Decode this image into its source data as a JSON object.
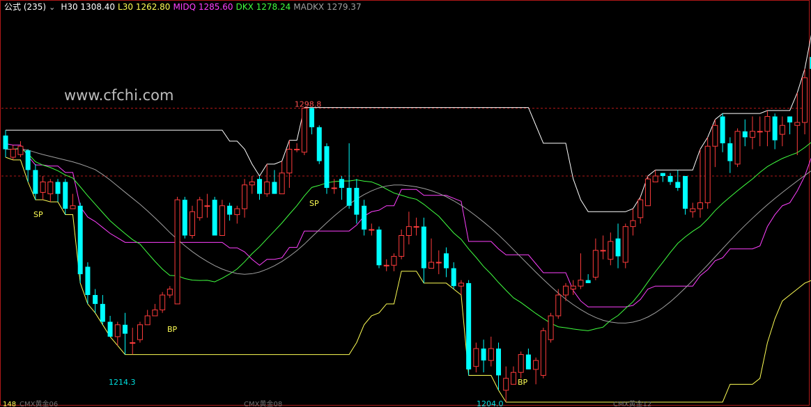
{
  "legend": {
    "formula": "公式 (235)",
    "chevron": "⌄",
    "items": [
      {
        "key": "H30",
        "text": "H30 1308.40",
        "color": "#ffffff"
      },
      {
        "key": "L30",
        "text": "L30 1262.80",
        "color": "#ffff55"
      },
      {
        "key": "MIDQ",
        "text": "MIDQ 1285.60",
        "color": "#ff40ff"
      },
      {
        "key": "DKX",
        "text": "DKX 1278.24",
        "color": "#40ff40"
      },
      {
        "key": "MADKX",
        "text": "MADKX 1279.37",
        "color": "#a0a0a0"
      }
    ]
  },
  "watermark": "www.cfchi.com",
  "colors": {
    "up": "#ff3c3c",
    "down": "#00ffff",
    "H30": "#ffffff",
    "L30": "#ffff55",
    "MIDQ": "#ff40ff",
    "DKX": "#40ff40",
    "MADKX": "#a0a0a0",
    "signal": "#ffff55",
    "grid": "#b01818"
  },
  "annotations": {
    "high_price": "1298.8",
    "low_price_1": "1214.3",
    "low_price_2": "1204.0"
  },
  "signals": [
    "SP",
    "SP",
    "BP",
    "BP"
  ],
  "bottom_labels": [
    "148",
    "CMX黄金06",
    "CMX黄金08",
    "CMX黄金12"
  ],
  "chart_data": {
    "type": "candlestick",
    "y_axis": {
      "min": 1200,
      "max": 1330
    },
    "reference_levels": [
      1298.8,
      1276.0
    ],
    "candles": [
      [
        1289.6,
        1285,
        1291.4,
        1282.3
      ],
      [
        1282.3,
        1285,
        1286.4,
        1281.4
      ],
      [
        1283.2,
        1286,
        1287.7,
        1282.3
      ],
      [
        1284.6,
        1278,
        1285,
        1274
      ],
      [
        1278,
        1270,
        1280,
        1268
      ],
      [
        1270.5,
        1274,
        1276,
        1268
      ],
      [
        1270,
        1274,
        1275,
        1267.3
      ],
      [
        1274,
        1270,
        1275,
        1267.3
      ],
      [
        1274,
        1265,
        1275,
        1263
      ],
      [
        1265,
        1266,
        1270,
        1265
      ],
      [
        1266,
        1243,
        1267,
        1240
      ],
      [
        1245.5,
        1236,
        1247,
        1233
      ],
      [
        1236,
        1233,
        1238,
        1230
      ],
      [
        1233,
        1227,
        1236,
        1226
      ],
      [
        1227,
        1222,
        1229,
        1222
      ],
      [
        1222,
        1226,
        1227,
        1219
      ],
      [
        1226,
        1223,
        1230,
        1216
      ],
      [
        1220,
        1220,
        1225,
        1216
      ],
      [
        1221,
        1226,
        1227,
        1220
      ],
      [
        1226,
        1229,
        1231,
        1226
      ],
      [
        1229,
        1231,
        1233,
        1229
      ],
      [
        1231,
        1236,
        1237,
        1230
      ],
      [
        1236,
        1238,
        1239,
        1235
      ],
      [
        1233,
        1268,
        1269,
        1233
      ],
      [
        1268,
        1256,
        1269,
        1255
      ],
      [
        1256,
        1264,
        1266,
        1255
      ],
      [
        1262,
        1268,
        1269,
        1261
      ],
      [
        1266,
        1266,
        1270,
        1262
      ],
      [
        1268,
        1256,
        1269,
        1256
      ],
      [
        1256,
        1266,
        1268,
        1256
      ],
      [
        1266,
        1263,
        1267,
        1261
      ],
      [
        1263,
        1265,
        1266,
        1260
      ],
      [
        1265,
        1273,
        1275,
        1262
      ],
      [
        1273,
        1274,
        1276,
        1270
      ],
      [
        1275,
        1270,
        1276,
        1268
      ],
      [
        1270,
        1274,
        1280,
        1269
      ],
      [
        1274,
        1270,
        1278,
        1270
      ],
      [
        1270,
        1277,
        1281,
        1270
      ],
      [
        1277,
        1285,
        1288,
        1272
      ],
      [
        1285,
        1285,
        1287,
        1284
      ],
      [
        1284,
        1298.8,
        1299,
        1283
      ],
      [
        1298.8,
        1292.4,
        1299,
        1290
      ],
      [
        1292.4,
        1281,
        1293,
        1280
      ],
      [
        1286,
        1272,
        1287,
        1270
      ],
      [
        1272,
        1272,
        1275,
        1270
      ],
      [
        1275,
        1272,
        1276,
        1268
      ],
      [
        1272,
        1266,
        1287,
        1265
      ],
      [
        1272,
        1263,
        1275,
        1260
      ],
      [
        1266,
        1258,
        1268,
        1256
      ],
      [
        1258,
        1258,
        1260,
        1256
      ],
      [
        1258,
        1246,
        1259,
        1245
      ],
      [
        1246,
        1246,
        1248,
        1244
      ],
      [
        1246,
        1249,
        1250,
        1244
      ],
      [
        1249,
        1256,
        1258,
        1248
      ],
      [
        1256,
        1259,
        1264,
        1253
      ],
      [
        1259,
        1259,
        1262,
        1256
      ],
      [
        1259,
        1245,
        1262,
        1240
      ],
      [
        1245,
        1247,
        1255,
        1245
      ],
      [
        1247,
        1247,
        1251,
        1243
      ],
      [
        1250,
        1245,
        1252,
        1242
      ],
      [
        1245,
        1239,
        1247,
        1238
      ],
      [
        1239,
        1240,
        1241,
        1236
      ],
      [
        1240,
        1211,
        1241,
        1209
      ],
      [
        1212,
        1218,
        1220,
        1210
      ],
      [
        1218,
        1214,
        1221,
        1210
      ],
      [
        1214,
        1218,
        1222,
        1212
      ],
      [
        1218,
        1209,
        1220,
        1204
      ],
      [
        1204,
        1208,
        1212,
        1200
      ],
      [
        1206,
        1210,
        1212,
        1206
      ],
      [
        1210,
        1216,
        1217,
        1208
      ],
      [
        1216,
        1211,
        1218,
        1211
      ],
      [
        1211,
        1214,
        1215,
        1206
      ],
      [
        1209,
        1224,
        1225,
        1208
      ],
      [
        1221,
        1229,
        1230,
        1220
      ],
      [
        1229,
        1236,
        1238,
        1228
      ],
      [
        1236,
        1239,
        1240,
        1234
      ],
      [
        1238,
        1239,
        1241,
        1236
      ],
      [
        1239,
        1241,
        1250,
        1238
      ],
      [
        1241,
        1240,
        1243,
        1240
      ],
      [
        1242,
        1251,
        1255,
        1241
      ],
      [
        1251,
        1251,
        1256,
        1248
      ],
      [
        1248,
        1254,
        1257,
        1246
      ],
      [
        1255,
        1249,
        1260,
        1245
      ],
      [
        1247,
        1259,
        1260,
        1245
      ],
      [
        1259,
        1261,
        1265,
        1256
      ],
      [
        1262,
        1268,
        1269,
        1260
      ],
      [
        1266,
        1275,
        1276,
        1266
      ],
      [
        1274,
        1276,
        1278,
        1274
      ],
      [
        1277,
        1276,
        1277,
        1274
      ],
      [
        1276,
        1274,
        1277,
        1273
      ],
      [
        1274,
        1272,
        1278,
        1271
      ],
      [
        1276,
        1265,
        1276,
        1263
      ],
      [
        1264,
        1265,
        1267,
        1262
      ],
      [
        1265,
        1267,
        1285,
        1262
      ],
      [
        1267,
        1286,
        1289,
        1265
      ],
      [
        1286,
        1293,
        1295,
        1279
      ],
      [
        1296,
        1287,
        1297,
        1284
      ],
      [
        1287,
        1281,
        1289,
        1277
      ],
      [
        1280,
        1291,
        1292,
        1279
      ],
      [
        1291,
        1289,
        1295,
        1286
      ],
      [
        1289,
        1291,
        1296,
        1285
      ],
      [
        1291,
        1291,
        1296,
        1286
      ],
      [
        1291,
        1296,
        1298,
        1286
      ],
      [
        1296,
        1288,
        1297,
        1285
      ],
      [
        1290,
        1293,
        1296,
        1286
      ],
      [
        1296,
        1294,
        1296,
        1290
      ],
      [
        1293,
        1294,
        1304,
        1283
      ],
      [
        1294,
        1309,
        1312,
        1290
      ],
      [
        1316,
        1312,
        1325,
        1308
      ],
      [
        1312,
        1308,
        1320,
        1308
      ],
      [
        1300,
        1320,
        1321,
        1295
      ]
    ],
    "series": [
      {
        "name": "H30",
        "values": [
          1298.8,
          1298.8,
          1298.8,
          1298.8,
          1298.8,
          1298.8,
          1298.8,
          1298.8,
          1298.8,
          1298.8,
          1298.8,
          1298.8,
          1298.8,
          1298.8,
          1298.8,
          1298.8,
          1298.8,
          1298.8,
          1298.8,
          1298.8,
          1298.8,
          1298.8,
          1298.8,
          1298.8,
          1298.8,
          1298.8,
          1298.8,
          1298.8,
          1298.8,
          1298.8,
          1298.8,
          1298.8,
          1298.8,
          1298.8,
          1298.8,
          1298.8,
          1298.8,
          1298.8,
          1298.8,
          1298.8,
          1298.8,
          1298.8,
          1298.8,
          1298.8,
          1298.8,
          1298.8,
          1298.8,
          1298.8,
          1298.8,
          1298.8,
          1298.8,
          1298.8,
          1298.8,
          1298.8,
          1298.8,
          1298.8,
          1298.8,
          1298.8,
          1298.8,
          1298.8,
          1298.8,
          1298.8,
          1298.8,
          1298.8,
          1298.8,
          1298.8,
          1298.8,
          1298.8,
          1298.8,
          1298.8,
          1298.8,
          1298.8,
          1298.8,
          1298.8,
          1298.8,
          1298.8,
          1298.8,
          1298.8,
          1298.8,
          1298.8,
          1298.8,
          1298.8,
          1298.8,
          1298.8,
          1298.8,
          1298.8,
          1298.8,
          1298.8,
          1298.8,
          1298.8,
          1298.8,
          1298.8,
          1298.8,
          1298.8,
          1298.8,
          1298.8,
          1298.8,
          1298.8,
          1298.8,
          1298.8,
          1298.8,
          1298.8,
          1298.8,
          1298.8,
          1298.8,
          1298.8,
          1298.8,
          1298.8,
          1308.4,
          1308.4
        ]
      },
      {
        "name": "L30",
        "values": [
          1214.3,
          1214.3,
          1214.3,
          1214.3,
          1214.3,
          1214.3,
          1214.3,
          1214.3,
          1214.3,
          1214.3,
          1214.3,
          1214.3,
          1214.3,
          1214.3,
          1214.3,
          1214.3,
          1214.3,
          1214.3,
          1214.3,
          1214.3,
          1214.3,
          1214.3,
          1214.3,
          1214.3,
          1214.3,
          1214.3,
          1214.3,
          1214.3,
          1214.3,
          1214.3,
          1214.3,
          1214.3,
          1214.3,
          1214.3,
          1214.3,
          1214.3,
          1214.3,
          1214.3,
          1214.3,
          1214.3,
          1214.3,
          1214.3,
          1214.3,
          1214.3,
          1214.3,
          1214.3,
          1214.3,
          1214.3,
          1214.3,
          1214.3,
          1214.3,
          1214.3,
          1214.3,
          1214.3,
          1214.3,
          1214.3,
          1214.3,
          1214.3,
          1214.3,
          1214.3,
          1214.3,
          1214.3,
          1214.3,
          1214.3,
          1214.3,
          1214.3,
          1204.0,
          1204.0,
          1204.0,
          1204.0,
          1204.0,
          1204.0,
          1204.0,
          1204.0,
          1204.0,
          1204.0,
          1204.0,
          1204.0,
          1204.0,
          1204.0,
          1204.0,
          1204.0,
          1204.0,
          1204.0,
          1204.0,
          1204.0,
          1204.0,
          1204.0,
          1204.0,
          1204.0,
          1204.0,
          1204.0,
          1204.0,
          1204.0,
          1204.0,
          1204.0,
          1204.0,
          1204.0,
          1204.0,
          1204.0,
          1204.0,
          1204.0,
          1204.0,
          1204.0,
          1204.0,
          1204.0,
          1204.0,
          1204.0,
          1262.8,
          1262.8
        ]
      },
      {
        "name": "MIDQ",
        "values": [
          1285.6,
          1285.6,
          1285.6,
          1285.6,
          1285.6,
          1285.6,
          1285.6,
          1285.6,
          1285.6,
          1285.6,
          1285.6,
          1285.6,
          1285.6,
          1285.6,
          1285.6,
          1285.6,
          1285.6,
          1285.6,
          1285.6,
          1285.6,
          1285.6,
          1285.6,
          1285.6,
          1285.6,
          1285.6,
          1285.6,
          1285.6,
          1285.6,
          1285.6,
          1285.6,
          1285.6,
          1285.6,
          1285.6,
          1285.6,
          1285.6,
          1285.6,
          1285.6,
          1285.6,
          1285.6,
          1285.6,
          1285.6,
          1285.6,
          1285.6,
          1285.6,
          1285.6,
          1285.6,
          1285.6,
          1285.6,
          1285.6,
          1285.6,
          1285.6,
          1285.6,
          1285.6,
          1285.6,
          1285.6,
          1285.6,
          1285.6,
          1285.6,
          1285.6,
          1285.6,
          1285.6,
          1285.6,
          1285.6,
          1285.6,
          1285.6,
          1285.6,
          1285.6,
          1285.6,
          1285.6,
          1285.6,
          1285.6,
          1285.6,
          1285.6,
          1285.6,
          1285.6,
          1285.6,
          1285.6,
          1285.6,
          1285.6,
          1285.6,
          1285.6,
          1285.6,
          1285.6,
          1285.6,
          1285.6,
          1285.6,
          1285.6,
          1285.6,
          1285.6,
          1285.6,
          1285.6,
          1285.6,
          1285.6,
          1285.6,
          1285.6,
          1285.6,
          1285.6,
          1285.6,
          1285.6,
          1285.6,
          1285.6,
          1285.6,
          1285.6,
          1285.6,
          1285.6,
          1285.6,
          1285.6,
          1285.6,
          1285.6,
          1285.6
        ]
      },
      {
        "name": "DKX",
        "values": [
          1278.24,
          1278.24,
          1278.24,
          1278.24,
          1278.24,
          1278.24,
          1278.24,
          1278.24,
          1278.24,
          1278.24,
          1278.24,
          1278.24,
          1278.24,
          1278.24,
          1278.24,
          1278.24,
          1278.24,
          1278.24,
          1278.24,
          1278.24,
          1278.24,
          1278.24,
          1278.24,
          1278.24,
          1278.24,
          1278.24,
          1278.24,
          1278.24,
          1278.24,
          1278.24,
          1278.24,
          1278.24,
          1278.24,
          1278.24,
          1278.24,
          1278.24,
          1278.24,
          1278.24,
          1278.24,
          1278.24,
          1278.24,
          1278.24,
          1278.24,
          1278.24,
          1278.24,
          1278.24,
          1278.24,
          1278.24,
          1278.24,
          1278.24,
          1278.24,
          1278.24,
          1278.24,
          1278.24,
          1278.24,
          1278.24,
          1278.24,
          1278.24,
          1278.24,
          1278.24,
          1278.24,
          1278.24,
          1278.24,
          1278.24,
          1278.24,
          1278.24,
          1278.24,
          1278.24,
          1278.24,
          1278.24,
          1278.24,
          1278.24,
          1278.24,
          1278.24,
          1278.24,
          1278.24,
          1278.24,
          1278.24,
          1278.24,
          1278.24,
          1278.24,
          1278.24,
          1278.24,
          1278.24,
          1278.24,
          1278.24,
          1278.24,
          1278.24,
          1278.24,
          1278.24,
          1278.24,
          1278.24,
          1278.24,
          1278.24,
          1278.24,
          1278.24,
          1278.24,
          1278.24,
          1278.24,
          1278.24,
          1278.24,
          1278.24,
          1278.24,
          1278.24,
          1278.24,
          1278.24,
          1278.24,
          1278.24,
          1278.24,
          1278.24
        ]
      },
      {
        "name": "MADKX",
        "values": [
          1279.37,
          1279.37,
          1279.37,
          1279.37,
          1279.37,
          1279.37,
          1279.37,
          1279.37,
          1279.37,
          1279.37,
          1279.37,
          1279.37,
          1279.37,
          1279.37,
          1279.37,
          1279.37,
          1279.37,
          1279.37,
          1279.37,
          1279.37,
          1279.37,
          1279.37,
          1279.37,
          1279.37,
          1279.37,
          1279.37,
          1279.37,
          1279.37,
          1279.37,
          1279.37,
          1279.37,
          1279.37,
          1279.37,
          1279.37,
          1279.37,
          1279.37,
          1279.37,
          1279.37,
          1279.37,
          1279.37,
          1279.37,
          1279.37,
          1279.37,
          1279.37,
          1279.37,
          1279.37,
          1279.37,
          1279.37,
          1279.37,
          1279.37,
          1279.37,
          1279.37,
          1279.37,
          1279.37,
          1279.37,
          1279.37,
          1279.37,
          1279.37,
          1279.37,
          1279.37,
          1279.37,
          1279.37,
          1279.37,
          1279.37,
          1279.37,
          1279.37,
          1279.37,
          1279.37,
          1279.37,
          1279.37,
          1279.37,
          1279.37,
          1279.37,
          1279.37,
          1279.37,
          1279.37,
          1279.37,
          1279.37,
          1279.37,
          1279.37,
          1279.37,
          1279.37,
          1279.37,
          1279.37,
          1279.37,
          1279.37,
          1279.37,
          1279.37,
          1279.37,
          1279.37,
          1279.37,
          1279.37,
          1279.37,
          1279.37,
          1279.37,
          1279.37,
          1279.37,
          1279.37,
          1279.37,
          1279.37,
          1279.37,
          1279.37,
          1279.37,
          1279.37,
          1279.37,
          1279.37,
          1279.37,
          1279.37,
          1279.37,
          1279.37
        ]
      }
    ]
  }
}
